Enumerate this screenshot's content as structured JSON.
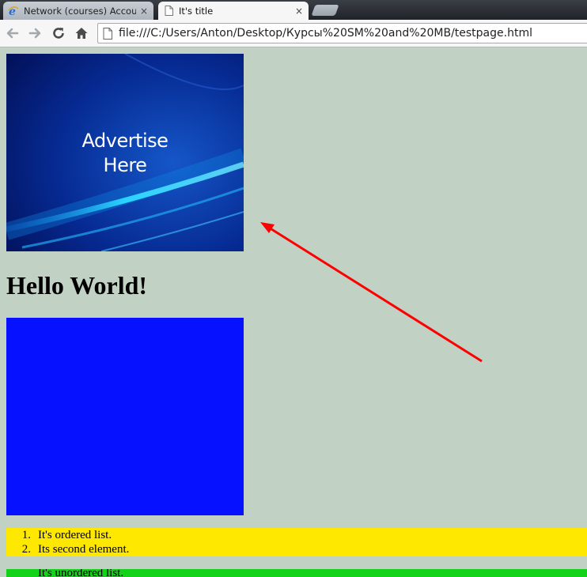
{
  "browser": {
    "tabs": [
      {
        "title": "Network (courses) Accour",
        "favicon": "ie-e-icon",
        "active": false
      },
      {
        "title": "It's title",
        "favicon": "page-icon",
        "active": true
      }
    ],
    "close_glyph": "×",
    "url": "file:///C:/Users/Anton/Desktop/Курсы%20SM%20and%20MB/testpage.html"
  },
  "page": {
    "ad": {
      "line1": "Advertise",
      "line2": "Here"
    },
    "heading": "Hello World!",
    "ordered_list": [
      "It's ordered list.",
      "Its second element."
    ],
    "unordered_list": [
      "It's unordered list."
    ]
  },
  "colors": {
    "page_background": "#c1d1c3",
    "blue_box": "#0511ff",
    "ordered_list_background": "#ffe800",
    "unordered_list_background": "#14d11a",
    "annotation_arrow": "#ff0000"
  }
}
